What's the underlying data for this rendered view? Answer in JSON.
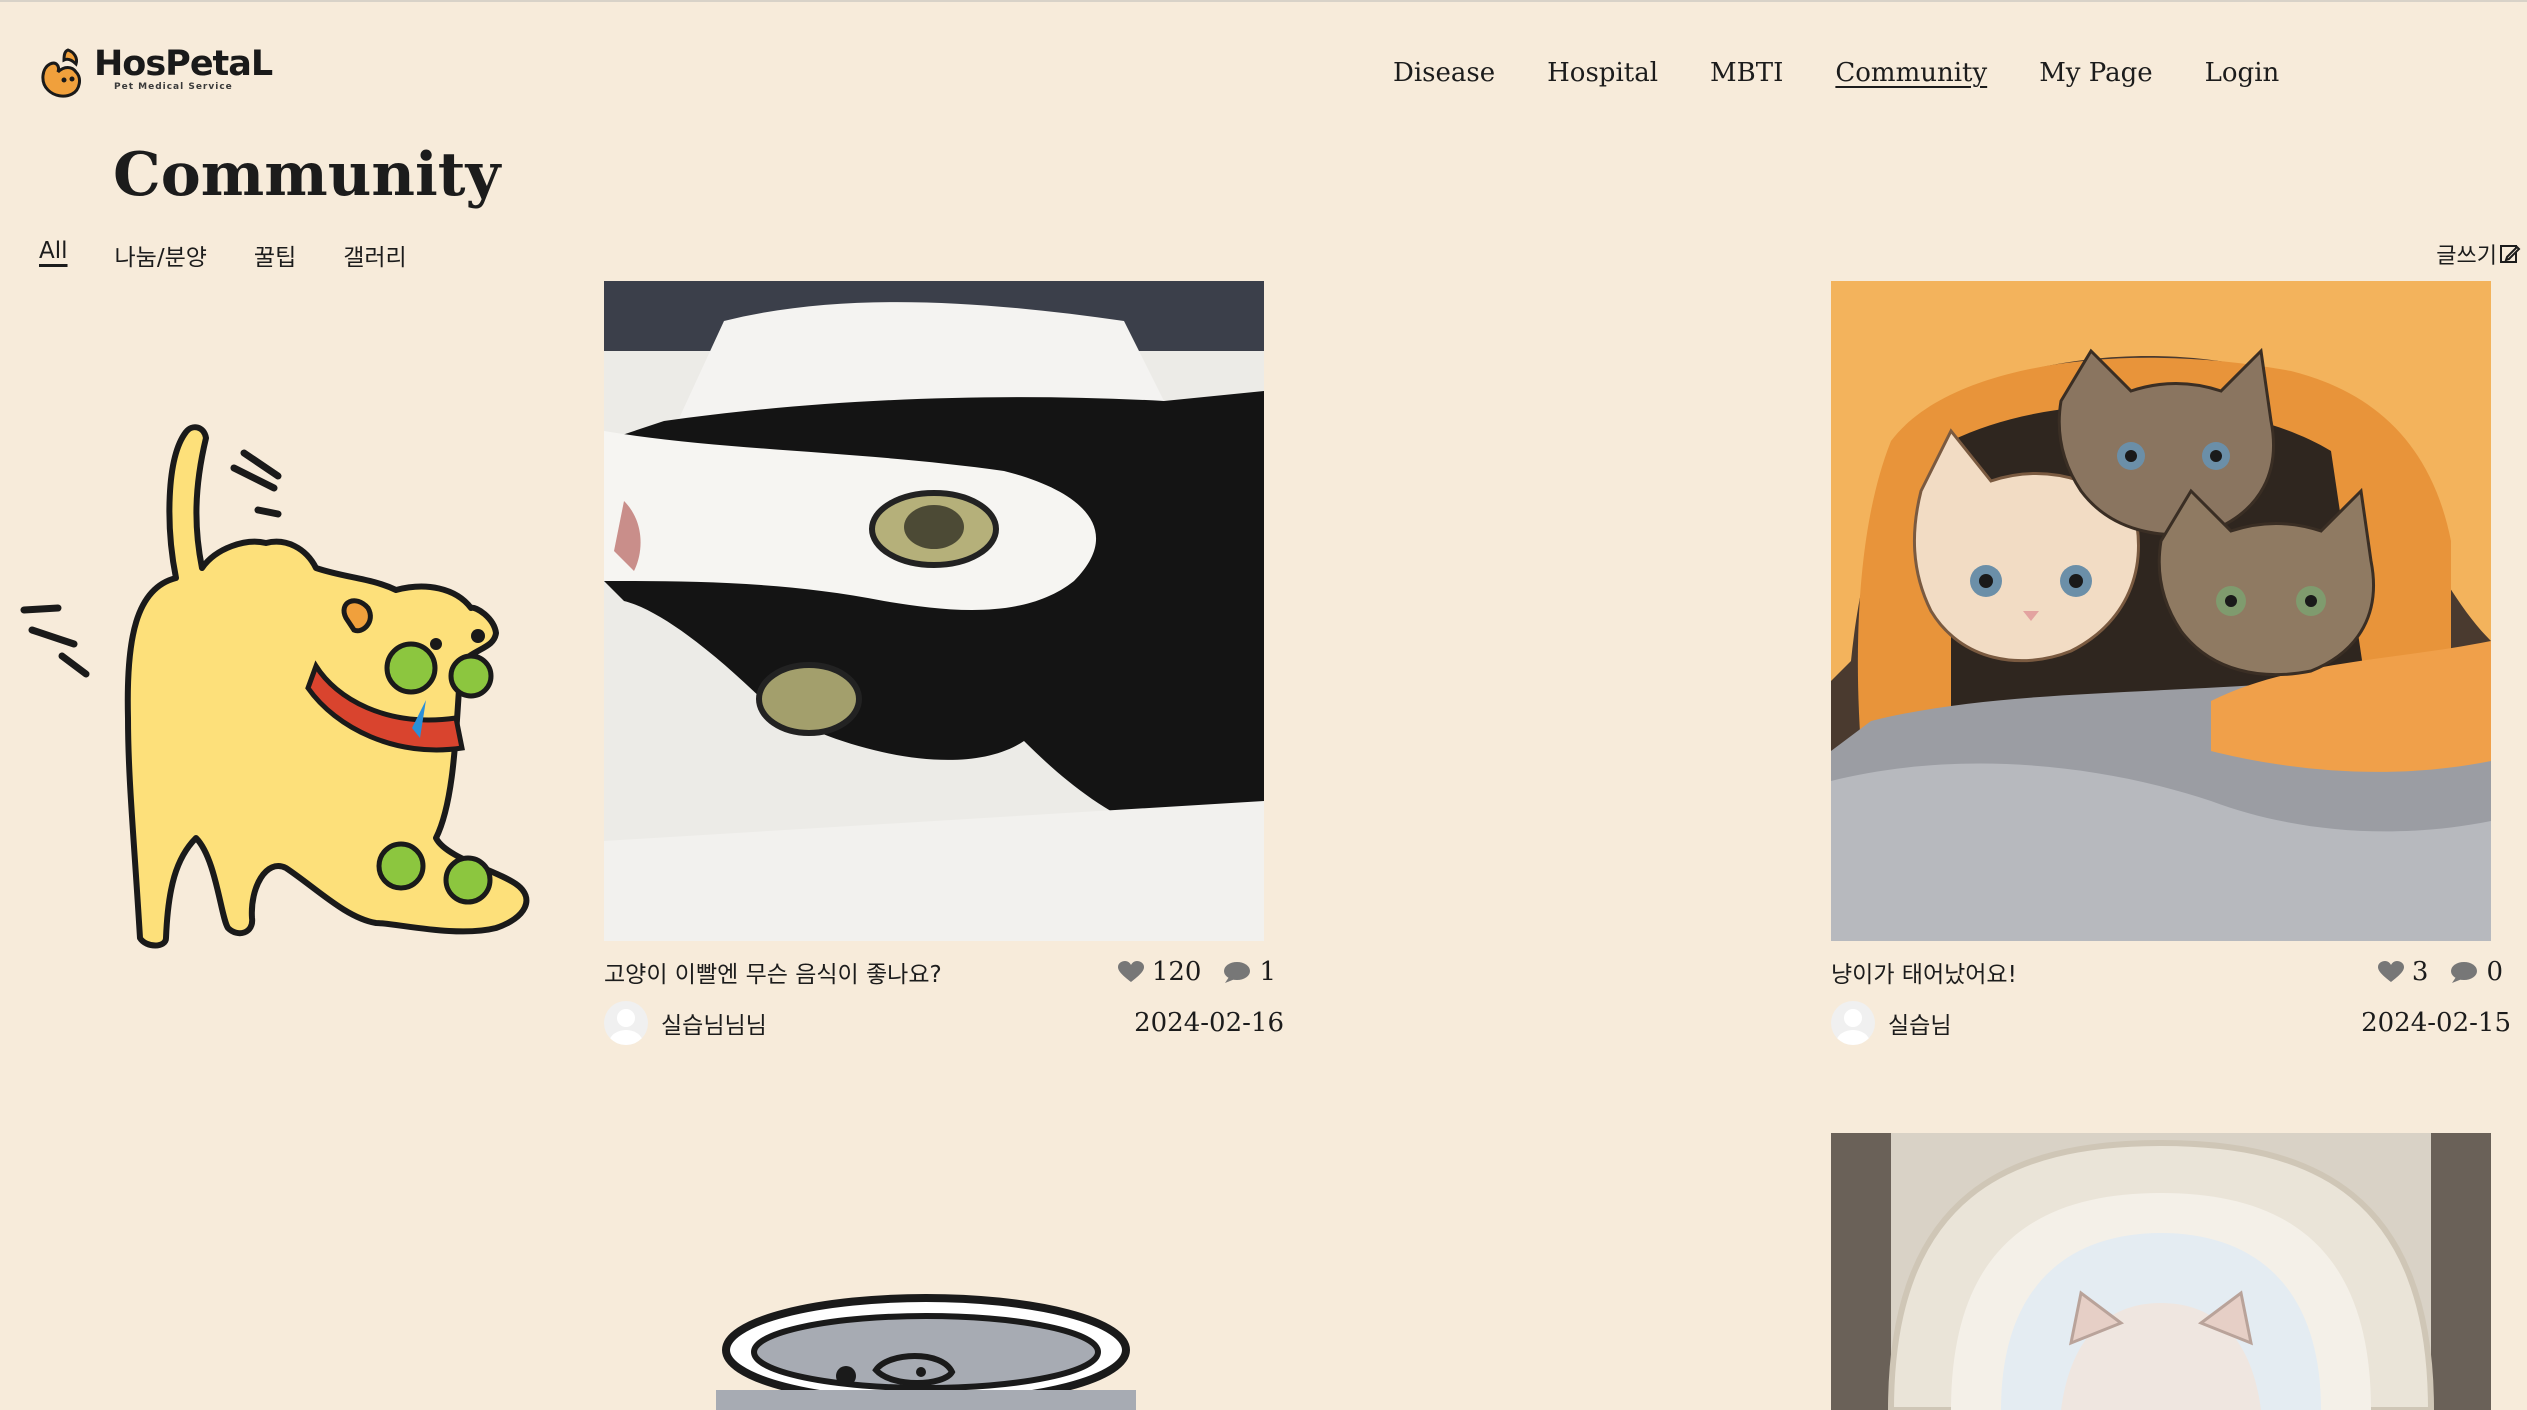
{
  "brand": {
    "name": "HosPetaL",
    "tagline": "Pet Medical Service"
  },
  "nav": [
    {
      "label": "Disease"
    },
    {
      "label": "Hospital"
    },
    {
      "label": "MBTI"
    },
    {
      "label": "Community",
      "active": true
    },
    {
      "label": "My Page"
    },
    {
      "label": "Login"
    }
  ],
  "page_title": "Community",
  "tabs": [
    {
      "label": "All",
      "active": true
    },
    {
      "label": "나눔/분양"
    },
    {
      "label": "꿀팁"
    },
    {
      "label": "갤러리"
    }
  ],
  "write_button": "글쓰기",
  "posts": [
    {
      "title": "고양이 이빨엔 무슨 음식이 좋나요?",
      "likes": "120",
      "comments": "1",
      "author": "실습님님님",
      "date": "2024-02-16",
      "photo": "black-and-white cat lying sideways"
    },
    {
      "title": "냥이가 태어났어요!",
      "likes": "3",
      "comments": "0",
      "author": "실습님",
      "date": "2024-02-15",
      "photo": "kittens in orange blanket"
    }
  ],
  "colors": {
    "background": "#f7ebda",
    "text": "#1c1c1c",
    "icon_gray": "#777777",
    "dog_yellow": "#fde07a",
    "collar_red": "#d9442e"
  }
}
